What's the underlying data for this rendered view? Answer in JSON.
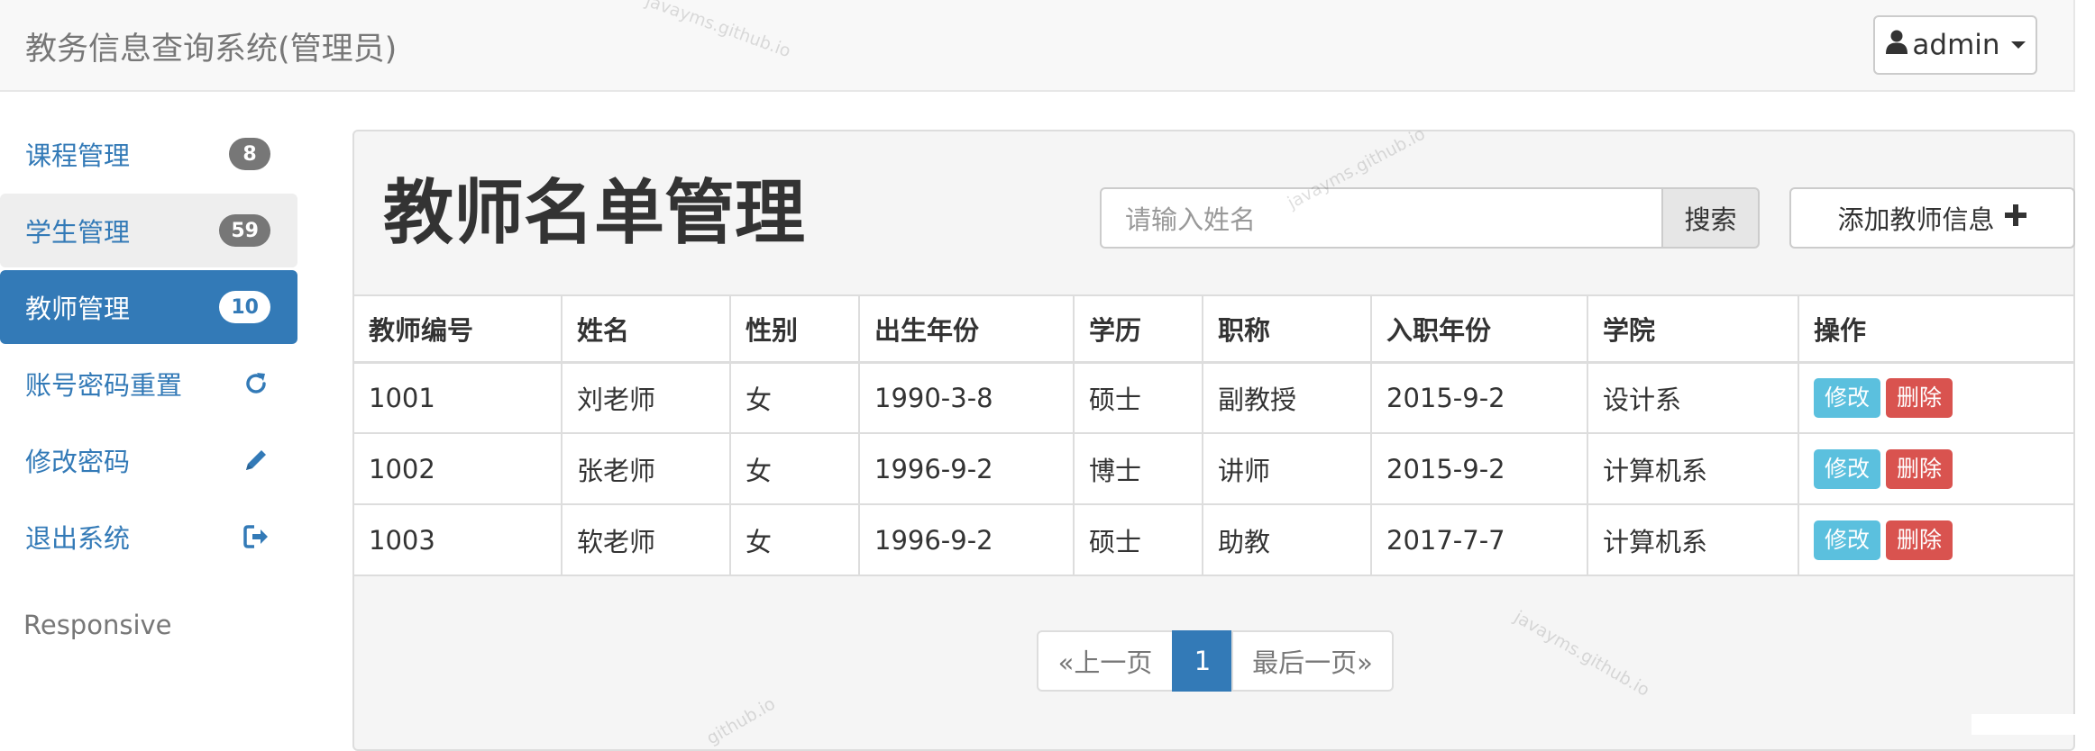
{
  "header": {
    "brand": "教务信息查询系统(管理员)",
    "user_label": "admin",
    "user_icon": "user-icon",
    "caret_icon": "caret-down-icon"
  },
  "sidebar": {
    "items": [
      {
        "label": "课程管理",
        "badge": "8"
      },
      {
        "label": "学生管理",
        "badge": "59"
      },
      {
        "label": "教师管理",
        "badge": "10"
      },
      {
        "label": "账号密码重置",
        "icon": "refresh-icon"
      },
      {
        "label": "修改密码",
        "icon": "pencil-icon"
      },
      {
        "label": "退出系统",
        "icon": "logout-icon"
      }
    ],
    "footer_text": "Responsive"
  },
  "main": {
    "title": "教师名单管理",
    "search": {
      "placeholder": "请输入姓名",
      "button_label": "搜索"
    },
    "add_button_label": "添加教师信息",
    "add_icon": "plus-icon",
    "table": {
      "columns": [
        "教师编号",
        "姓名",
        "性别",
        "出生年份",
        "学历",
        "职称",
        "入职年份",
        "学院",
        "操作"
      ],
      "rows": [
        [
          "1001",
          "刘老师",
          "女",
          "1990-3-8",
          "硕士",
          "副教授",
          "2015-9-2",
          "设计系"
        ],
        [
          "1002",
          "张老师",
          "女",
          "1996-9-2",
          "博士",
          "讲师",
          "2015-9-2",
          "计算机系"
        ],
        [
          "1003",
          "软老师",
          "女",
          "1996-9-2",
          "硕士",
          "助教",
          "2017-7-7",
          "计算机系"
        ]
      ],
      "edit_label": "修改",
      "delete_label": "删除"
    },
    "pagination": {
      "prev": "«上一页",
      "current": "1",
      "last": "最后一页»"
    }
  },
  "watermarks": [
    "javayms.github.io",
    "javayms.github.io",
    "javayms.github.io",
    "github.io"
  ],
  "colors": {
    "primary": "#337ab7",
    "info": "#5bc0de",
    "danger": "#d9534f",
    "badge": "#777777"
  }
}
